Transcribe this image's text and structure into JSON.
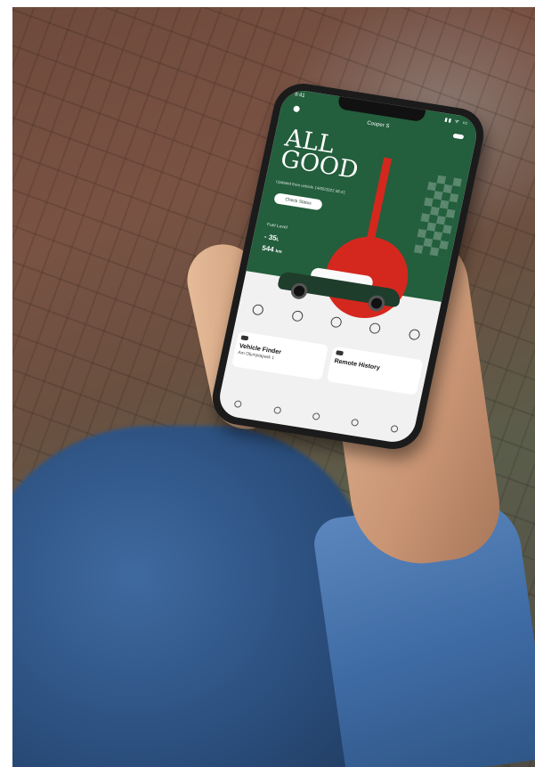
{
  "app": {
    "status_time": "9:41",
    "status_icons": "▮▮ ᯤ ▭",
    "car_title": "Cooper S",
    "headline_line1": "ALL",
    "headline_line2": "GOOD",
    "updated_text": "Updated from vehicle 14/05/2022 06:41",
    "check_status_label": "Check Status",
    "fuel": {
      "label": "Fuel Level",
      "range": "- 35",
      "range_unit": "L",
      "distance": "544",
      "distance_unit": "km"
    },
    "cards": [
      {
        "title": "Vehicle Finder",
        "subtitle": "Am Olympiapark 1"
      },
      {
        "title": "Remote History",
        "subtitle": ""
      }
    ],
    "accent_green": "#235e3d",
    "accent_red": "#d4281e"
  }
}
